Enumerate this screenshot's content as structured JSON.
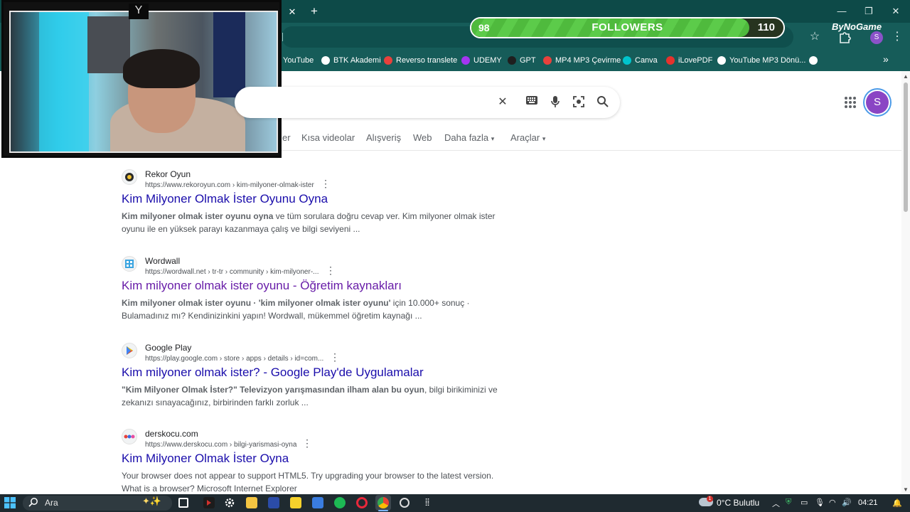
{
  "browser": {
    "tab_close": "✕",
    "tab_new": "+",
    "window": {
      "minimize": "—",
      "restore": "❐",
      "close": "✕"
    },
    "star": "☆",
    "profile_initial": "S",
    "menu": "⋮",
    "bookmarks": [
      {
        "label": "YouTube",
        "color": "#ff0000"
      },
      {
        "label": "BTK Akademi",
        "color": "#ffffff"
      },
      {
        "label": "Reverso translete",
        "color": "#e8413c"
      },
      {
        "label": "UDEMY",
        "color": "#a435f0"
      },
      {
        "label": "GPT",
        "color": "#1f1f1f"
      },
      {
        "label": "MP4 MP3 Çevirme",
        "color": "#e8413c"
      },
      {
        "label": "Canva",
        "color": "#00c4cc"
      },
      {
        "label": "iLovePDF",
        "color": "#e5322d"
      },
      {
        "label": "YouTube MP3 Dönü...",
        "color": "#ffffff"
      },
      {
        "label": "",
        "color": "#ffffff"
      }
    ],
    "bookmarks_more": "»"
  },
  "overlay": {
    "followers_label": "FOLLOWERS",
    "followers_current": "98",
    "followers_goal": "110",
    "followers_fraction": 0.8909,
    "brand": "ByNoGame"
  },
  "google": {
    "account_initial": "S",
    "tabs": [
      "er",
      "Kısa videolar",
      "Alışveriş",
      "Web",
      "Daha fazla",
      "Araçlar"
    ],
    "tab_caret": "▾"
  },
  "results": [
    {
      "site_name": "Rekor Oyun",
      "url": "https://www.rekoroyun.com › kim-milyoner-olmak-ister",
      "title": "Kim Milyoner Olmak İster Oyunu Oyna",
      "visited": false,
      "snippet_bold": "Kim milyoner olmak ister oyunu oyna",
      "snippet_rest": " ve tüm sorulara doğru cevap ver. Kim milyoner olmak ister oyunu ile en yüksek parayı kazanmaya çalış ve bilgi seviyeni ..."
    },
    {
      "site_name": "Wordwall",
      "url": "https://wordwall.net › tr-tr › community › kim-milyoner-...",
      "title": "Kim milyoner olmak ister oyunu - Öğretim kaynakları",
      "visited": true,
      "snippet_bold": "Kim milyoner olmak ister oyunu · 'kim milyoner olmak ister oyunu'",
      "snippet_rest": " için 10.000+ sonuç · Bulamadınız mı? Kendinizinkini yapın! Wordwall, mükemmel öğretim kaynağı ..."
    },
    {
      "site_name": "Google Play",
      "url": "https://play.google.com › store › apps › details › id=com...",
      "title": "Kim milyoner olmak ister? - Google Play'de Uygulamalar",
      "visited": false,
      "snippet_bold": "\"Kim Milyoner Olmak İster?\" Televizyon yarışmasından ilham alan bu oyun",
      "snippet_rest": ", bilgi birikiminizi ve zekanızı sınayacağınız, birbirinden farklı zorluk ..."
    },
    {
      "site_name": "derskocu.com",
      "url": "https://www.derskocu.com › bilgi-yarismasi-oyna",
      "title": "Kim Milyoner Olmak İster Oyna",
      "visited": false,
      "snippet_bold": "",
      "snippet_rest": "Your browser does not appear to support HTML5. Try upgrading your browser to the latest version. What is a browser? Microsoft Internet Explorer"
    }
  ],
  "taskbar": {
    "search_placeholder": "Ara",
    "weather": "0°C Bulutlu",
    "weather_badge": "1",
    "clock": "04:21"
  }
}
